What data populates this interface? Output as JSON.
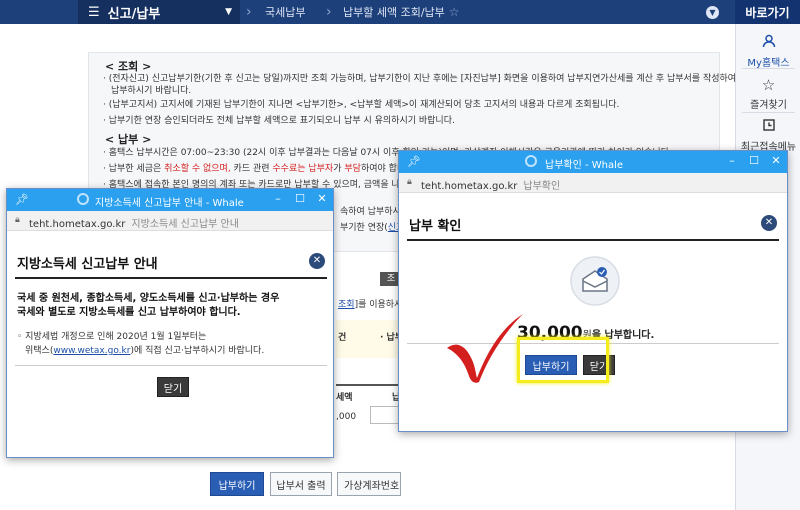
{
  "header": {
    "menu_title": "신고/납부",
    "breadcrumb": [
      "국세납부",
      "납부할 세액 조회/납부"
    ],
    "quicklinks_title": "바로가기"
  },
  "sidepanel": {
    "items": [
      {
        "label": "My홈택스",
        "icon": "person-icon"
      },
      {
        "label": "즐겨찾기",
        "icon": "star-icon"
      },
      {
        "label": "최근접속메뉴",
        "icon": "history-icon"
      }
    ]
  },
  "background": {
    "section_inquiry": "< 조회 >",
    "inquiry_items": [
      "(전자신고) 신고납부기한(기한 후 신고는 당일)까지만 조회 가능하며, 납부기한이 지난 후에는 [자진납부] 화면을 이용하여 납부지연가산세를 계산 후 납부서를 작성하여",
      "납부하시기 바랍니다.",
      "(납부고지서) 고지서에 기재된 납부기한이 지나면 <납부기한>, <납부할 세액>이 재계산되어 당초 고지서의 내용과 다르게 조회됩니다.",
      "납부기한 연장 승인되더라도 전체 납부할 세액으로 표기되오니 납부 시 유의하시기 바랍니다."
    ],
    "section_payment": "< 납부 >",
    "payment_items": [
      "홈택스 납부시간은 07:00~23:30 (22시 이후 납부결과는 다음날 07시 이후 확인 가능)이며, 가상계좌 이체시간은 금융기관에 따라 차이가 있습니다.",
      "납부한 세금은 ",
      "취소할 수 없으며,",
      " 카드 관련 ",
      "수수료는 납부자",
      "가 ",
      "부담",
      "하여야 합니다.",
      "홈택스에 접속한 본인 명의의 계좌 또는 카드로만 납부할 수 있으며, 금액을 나누어"
    ],
    "frag_sok": "속하여 납부하시기",
    "frag_ext_pre": "부기한 연장(",
    "frag_ext_link": "신고분,고",
    "frag_btn": "조",
    "frag_query_link": "조회",
    "frag_query_rest": "]를 이용하시",
    "frag_gun": "건",
    "frag_dash": "· 납부",
    "frag_amt_head": "세액",
    "frag_amt_head2": "납",
    "frag_amt": ",000",
    "bottom_buttons": [
      "납부하기",
      "납부서 출력",
      "가상계좌번호"
    ]
  },
  "left_popup": {
    "window_title": "지방소득세 신고납부 안내 - Whale",
    "url": "teht.hometax.go.kr",
    "page_title": "지방소득세 신고납부 안내",
    "heading": "지방소득세 신고납부 안내",
    "bold_line1": "국세 중 원천세, 종합소득세, 양도소득세를 신고·납부하는 경우",
    "bold_line2": "국세와 별도로 지방소득세를 신고 납부하여야 합니다.",
    "note_line1": "◦ 지방세법 개정으로 인해 2020년 1월 1일부터는",
    "note_line2_pre": "위택스(",
    "note_link": "www.wetax.go.kr",
    "note_line2_post": ")에 직접 신고·납부하시기 바랍니다.",
    "close_button": "닫기"
  },
  "right_popup": {
    "window_title": "납부확인 - Whale",
    "url": "teht.hometax.go.kr",
    "page_title": "납부확인",
    "heading": "납부 확인",
    "amount": "30,000",
    "amount_unit": "원",
    "amount_suffix": "을 납부합니다.",
    "pay_button": "납부하기",
    "close_button": "닫기"
  },
  "colors": {
    "header_bg": "#1d3f7a",
    "popup_title_bg": "#2aa0ef",
    "primary_button": "#2a5eb5",
    "highlight": "#f5ec1c",
    "checkmark": "#d41f1f"
  }
}
